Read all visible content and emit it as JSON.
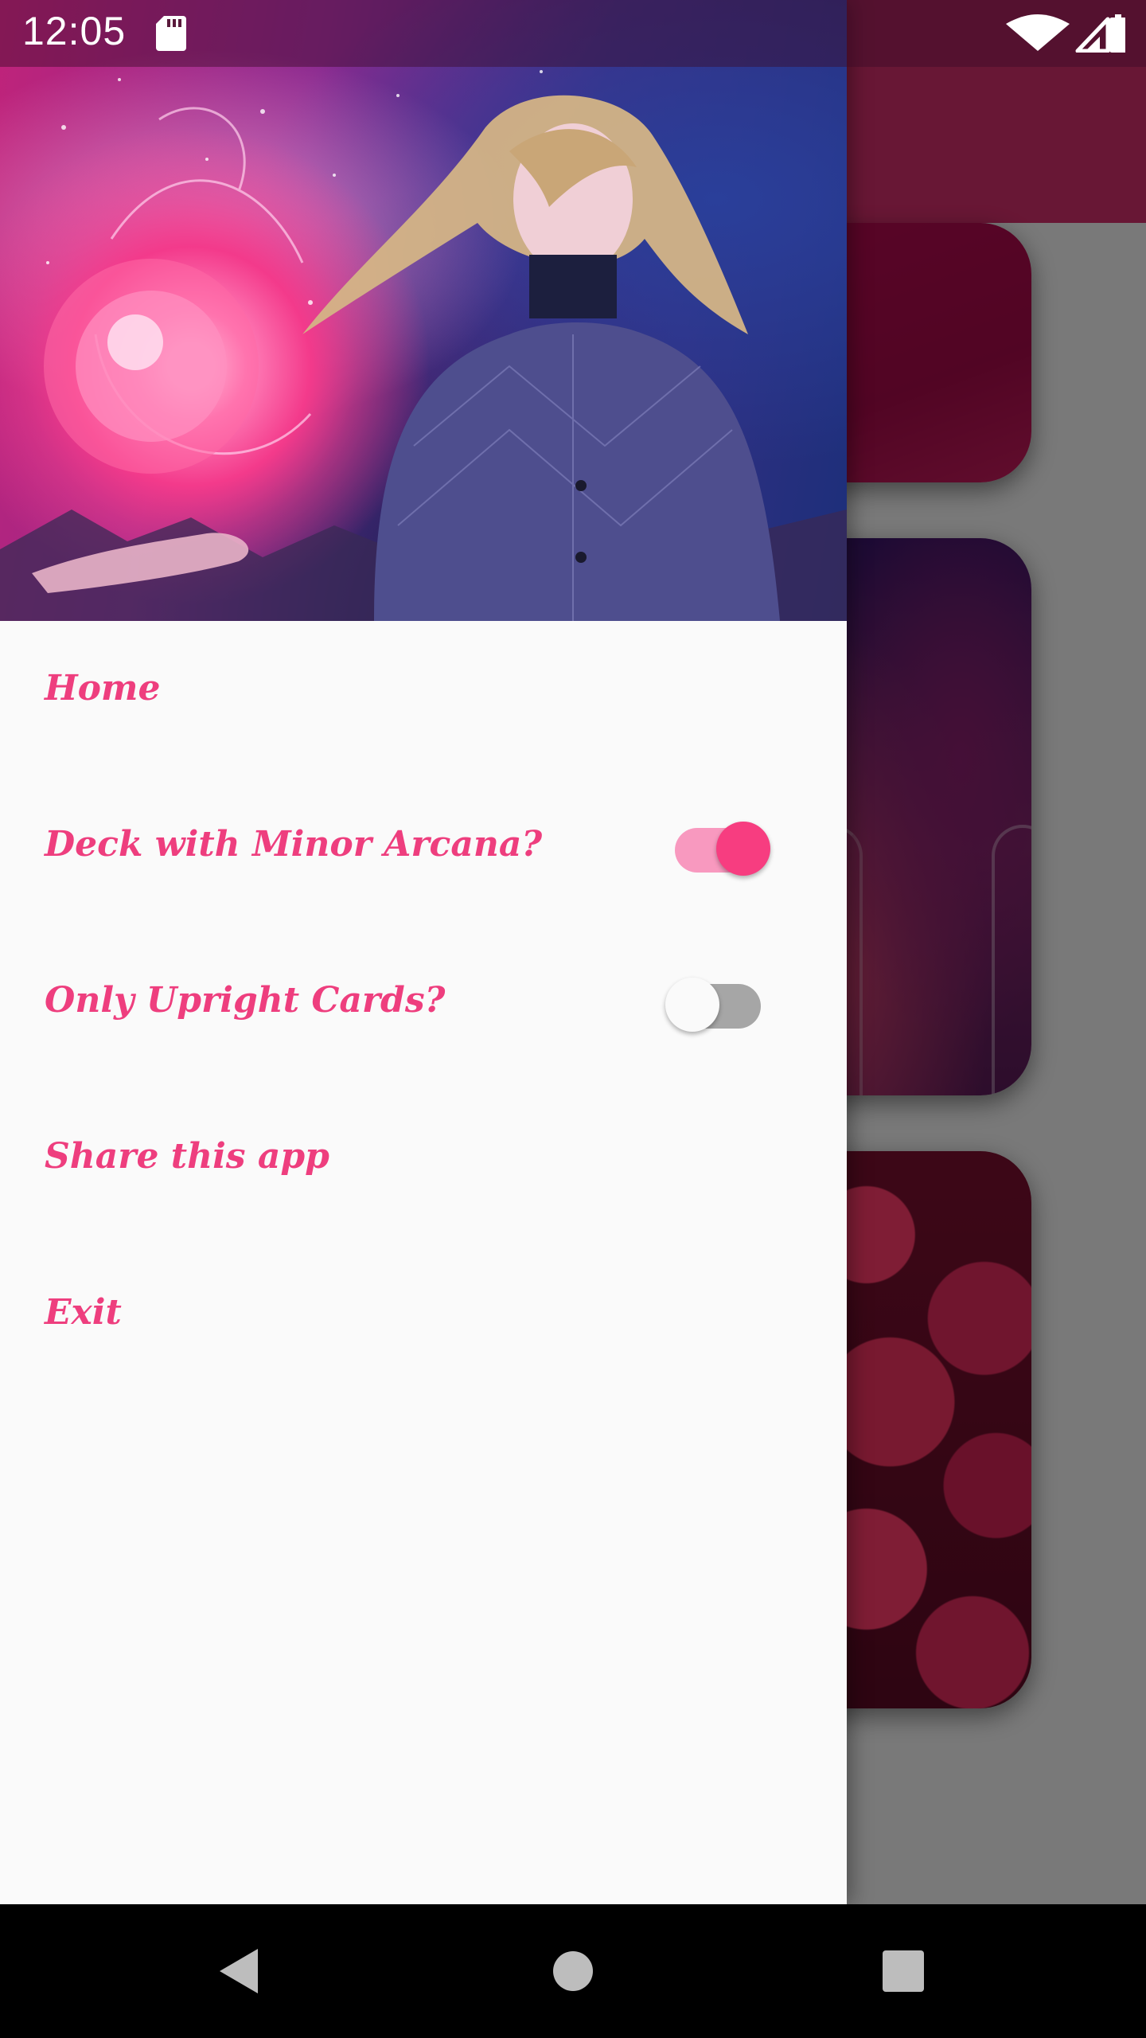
{
  "status_bar": {
    "time": "12:05",
    "icons": [
      "sd-card-icon",
      "wifi-icon",
      "cellular-signal-icon",
      "battery-icon"
    ]
  },
  "drawer": {
    "header_image": "woman-with-glowing-orb",
    "menu": {
      "home": "Home",
      "minor_arcana": "Deck with Minor Arcana?",
      "upright_only": "Only Upright Cards?",
      "share": "Share this app",
      "exit": "Exit"
    },
    "toggles": {
      "minor_arcana": true,
      "upright_only": false
    }
  },
  "nav_bar": {
    "buttons": [
      "back-icon",
      "home-icon",
      "recents-icon"
    ]
  },
  "colors": {
    "accent": "#ee3e7e",
    "switch_on_thumb": "#f73d80",
    "switch_on_track": "#f899bf",
    "switch_off_track": "#a6a6a6",
    "toolbar": "#d12e6a",
    "drawer_background": "#fafafa",
    "nav_bar": "#000000"
  }
}
